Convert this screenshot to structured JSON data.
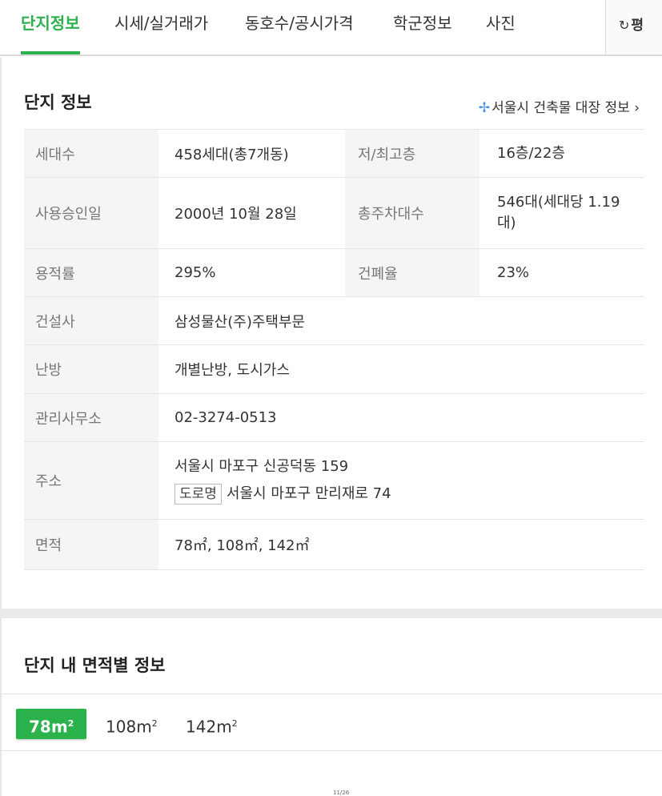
{
  "tabs": [
    "단지정보",
    "시세/실거래가",
    "동호수/공시가격",
    "학군정보",
    "사진"
  ],
  "unit_toggle": {
    "icon": "refresh-icon",
    "label": "평"
  },
  "section1": {
    "title": "단지 정보",
    "link": {
      "icon": "seoul-logo-icon",
      "label": "서울시 건축물 대장 정보",
      "chevron": "›"
    }
  },
  "info": {
    "households_label": "세대수",
    "households": "458세대(총7개동)",
    "floors_label": "저/최고층",
    "floors": "16층/22층",
    "approval_label": "사용승인일",
    "approval": "2000년 10월 28일",
    "parking_label": "총주차대수",
    "parking": "546대(세대당 1.19대)",
    "far_label": "용적률",
    "far": "295%",
    "bcr_label": "건폐율",
    "bcr": "23%",
    "builder_label": "건설사",
    "builder": "삼성물산(주)주택부문",
    "heating_label": "난방",
    "heating": "개별난방, 도시가스",
    "office_label": "관리사무소",
    "office": "02-3274-0513",
    "address_label": "주소",
    "address_lot": "서울시 마포구 신공덕동 159",
    "road_badge": "도로명",
    "address_road": "서울시 마포구 만리재로 74",
    "area_label": "면적",
    "area": "78㎡, 108㎡, 142㎡"
  },
  "section2": {
    "title": "단지 내 면적별 정보"
  },
  "area_tabs": [
    "78",
    "108",
    "142"
  ],
  "area_unit": "m",
  "area_unit_sup": "2",
  "tiny_label": "11/26"
}
